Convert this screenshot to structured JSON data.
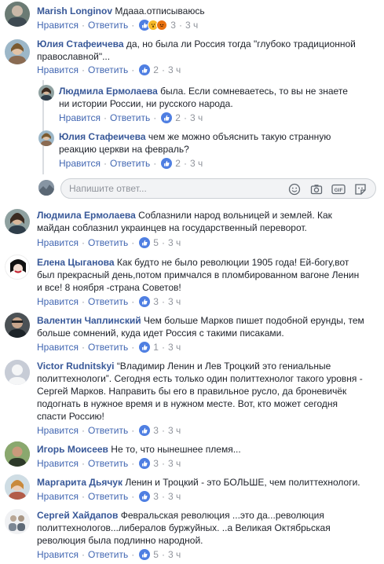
{
  "comments": [
    {
      "author": "Marish Longinov",
      "text": "Мдааа.отписываюсь",
      "lines": [],
      "like": "Нравится",
      "reply": "Ответить",
      "reactions": "3",
      "time": "3 ч"
    },
    {
      "author": "Юлия Стафеичева",
      "text": "да, но была ли Россия тогда \"глубоко традиционной",
      "lines": [
        "православной\"..."
      ],
      "like": "Нравится",
      "reply": "Ответить",
      "reactions": "2",
      "time": "3 ч"
    },
    {
      "author": "Людмила Ермолаева",
      "text": "была. Если сомневаетесь, то вы не знаете",
      "lines": [
        "ни истории России, ни русского народа."
      ],
      "like": "Нравится",
      "reply": "Ответить",
      "reactions": "2",
      "time": "3 ч"
    },
    {
      "author": "Юлия Стафеичева",
      "text": "чем же можно объяснить такую странную",
      "lines": [
        "реакцию церкви на февраль?"
      ],
      "like": "Нравится",
      "reply": "Ответить",
      "reactions": "2",
      "time": "3 ч"
    },
    {
      "author": "Людмила Ермолаева",
      "text": "Соблазнили народ вольницей и землей. Как",
      "lines": [
        "майдан соблазнил украинцев на государственный переворот."
      ],
      "like": "Нравится",
      "reply": "Ответить",
      "reactions": "5",
      "time": "3 ч"
    },
    {
      "author": "Елена Цыганова",
      "text": "Как будто не было революции 1905 года! Ей-богу,вот",
      "lines": [
        "был прекрасный день,потом примчался в пломбированном вагоне Ленин",
        "и все! 8 ноября -страна Советов!"
      ],
      "like": "Нравится",
      "reply": "Ответить",
      "reactions": "3",
      "time": "3 ч"
    },
    {
      "author": "Валентин Чаплинский",
      "text": "Чем больше Марков пишет подобной ерунды, тем",
      "lines": [
        "больше сомнений, куда идет Россия с такими писаками."
      ],
      "like": "Нравится",
      "reply": "Ответить",
      "reactions": "1",
      "time": "3 ч"
    },
    {
      "author": "Victor Rudnitskyi",
      "text": "“Владимир Ленин и Лев Троцкий это гениальные",
      "lines": [
        "политтехнологи”. Сегодня есть только один политтехнолог такого уровня -",
        "Сергей Марков. Направить бы его в правильное русло, да броневичёк",
        "подогнать в нужное время и в нужном месте. Вот, кто может сегодня",
        "спасти Россию!"
      ],
      "like": "Нравится",
      "reply": "Ответить",
      "reactions": "3",
      "time": "3 ч"
    },
    {
      "author": "Игорь Моисеев",
      "text": "Не то, что нынешнее племя...",
      "lines": [],
      "like": "Нравится",
      "reply": "Ответить",
      "reactions": "3",
      "time": "3 ч"
    },
    {
      "author": "Маргарита Дьячук",
      "text": "Ленин и Троцкий - это БОЛЬШЕ, чем политтехнологи.",
      "lines": [],
      "like": "Нравится",
      "reply": "Ответить",
      "reactions": "3",
      "time": "3 ч"
    },
    {
      "author": "Сергей Хайдапов",
      "text": "Февральская революция ...это да...революция",
      "lines": [
        "политтехнологов...либералов буржуйных. ..а Великая Октябрьская",
        "революция была подлинно народной."
      ],
      "like": "Нравится",
      "reply": "Ответить",
      "reactions": "5",
      "time": "3 ч"
    }
  ],
  "reply_box": {
    "placeholder": "Напишите ответ..."
  },
  "icons": [
    "smiley-icon",
    "camera-icon",
    "gif-icon",
    "sticker-icon",
    "like-icon",
    "wow-icon",
    "angry-icon"
  ],
  "colors": {
    "author": "#385898",
    "link": "#4267b2",
    "muted": "#90949c",
    "like": "#4f7fe2"
  }
}
